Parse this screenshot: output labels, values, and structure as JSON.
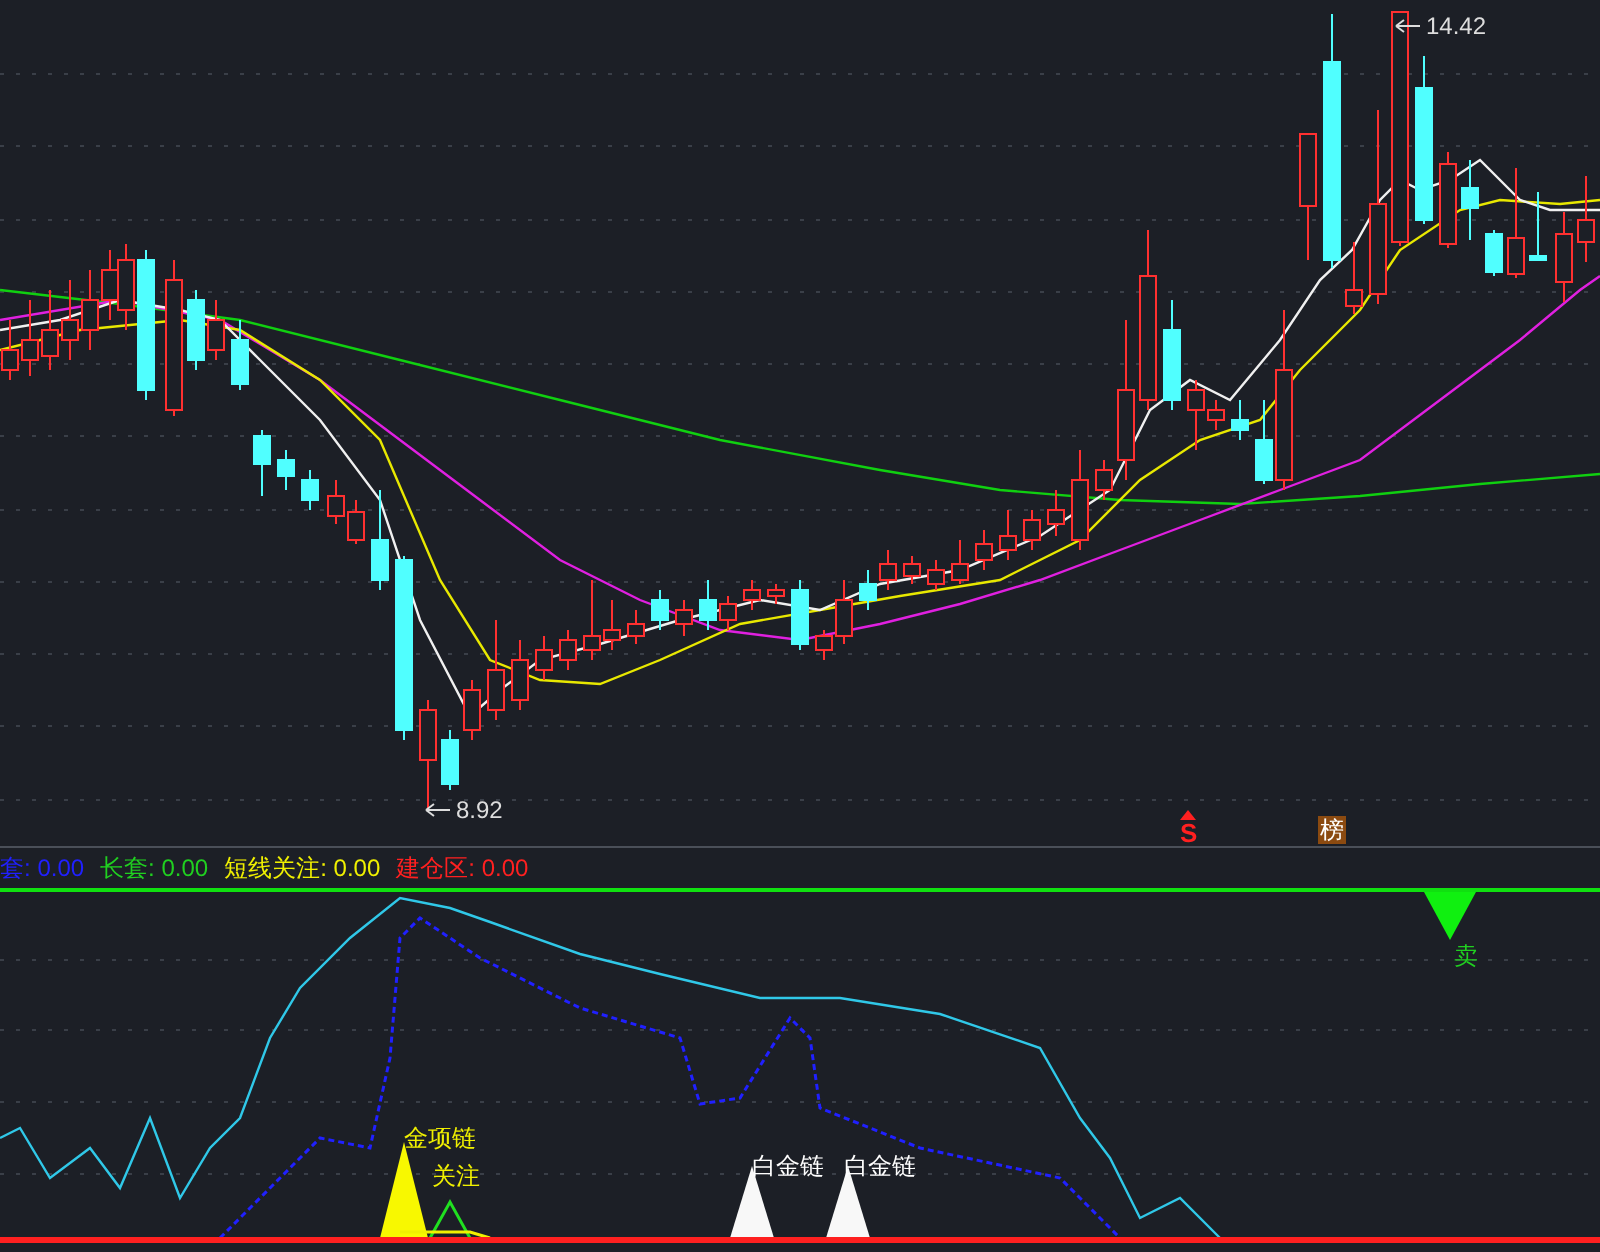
{
  "price_chart": {
    "high_label": "14.42",
    "low_label": "8.92",
    "signals": [
      {
        "kind": "arrow-s",
        "text": "S",
        "color": "#ff2020"
      },
      {
        "kind": "box",
        "text": "榜",
        "color": "#8b4a10"
      }
    ]
  },
  "legend": [
    {
      "label": "套:",
      "value": "0.00",
      "color": "#2020ff"
    },
    {
      "label": "长套:",
      "value": "0.00",
      "color": "#20d020"
    },
    {
      "label": "短线关注:",
      "value": "0.00",
      "color": "#f0f000"
    },
    {
      "label": "建仓区:",
      "value": "0.00",
      "color": "#ff2020"
    }
  ],
  "indicator": {
    "labels": [
      {
        "kind": "gold",
        "text": "金项链"
      },
      {
        "kind": "watch",
        "text": "关注"
      },
      {
        "kind": "platinum",
        "text": "白金链"
      },
      {
        "kind": "platinum",
        "text": "白金链"
      },
      {
        "kind": "sell",
        "text": "卖"
      }
    ]
  }
}
